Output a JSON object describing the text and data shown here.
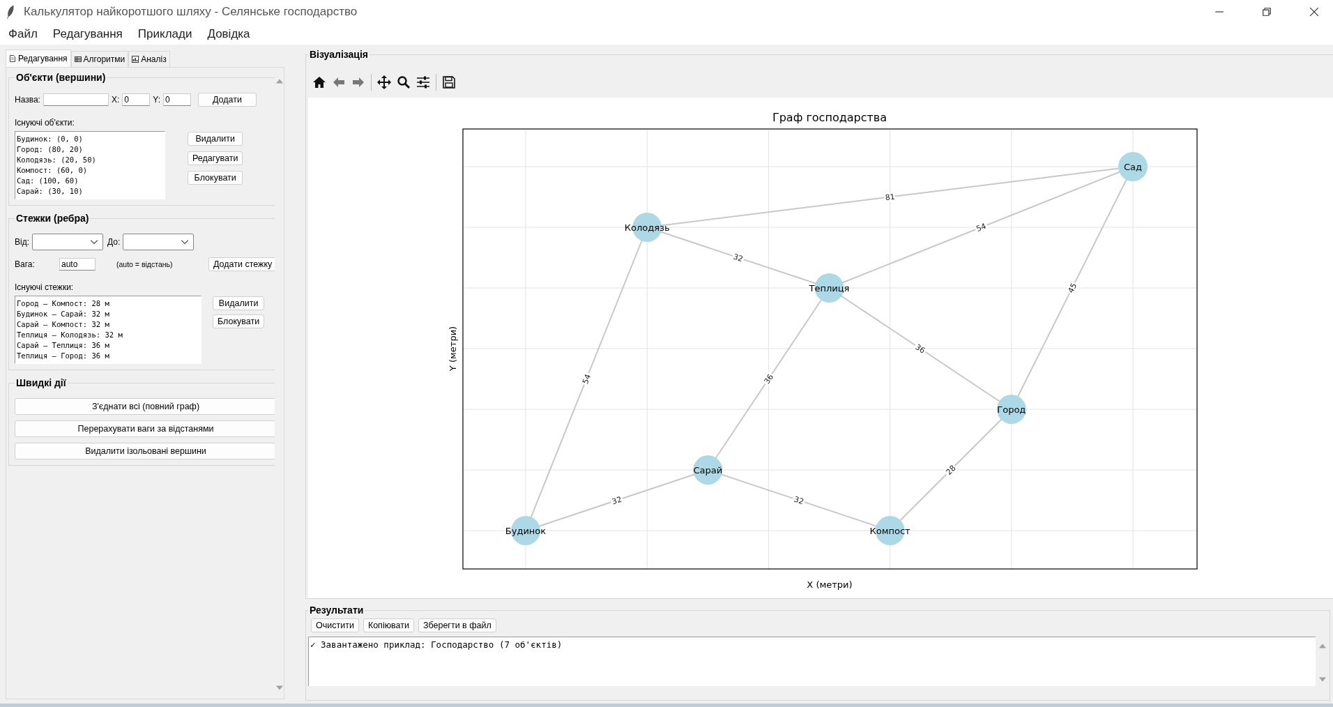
{
  "window": {
    "title": "Калькулятор найкоротшого шляху - Селянське господарство"
  },
  "menu": [
    "Файл",
    "Редагування",
    "Приклади",
    "Довідка"
  ],
  "tabs": [
    {
      "label": "Редагування",
      "selected": true
    },
    {
      "label": "Алгоритми",
      "selected": false
    },
    {
      "label": "Аналіз",
      "selected": false
    }
  ],
  "objects": {
    "title": "Об'єкти (вершини)",
    "name_label": "Назва:",
    "x_label": "X:",
    "x_value": "0",
    "y_label": "Y:",
    "y_value": "0",
    "add_button": "Додати",
    "list_label": "Існуючі об'єкти:",
    "items": [
      "Будинок: (0, 0)",
      "Город: (80, 20)",
      "Колодязь: (20, 50)",
      "Компост: (60, 0)",
      "Сад: (100, 60)",
      "Сарай: (30, 10)"
    ],
    "buttons": [
      "Видалити",
      "Редагувати",
      "Блокувати"
    ]
  },
  "paths": {
    "title": "Стежки (ребра)",
    "from_label": "Від:",
    "to_label": "До:",
    "weight_label": "Вага:",
    "weight_value": "auto",
    "hint": "(auto = відстань)",
    "add_button": "Додати стежку",
    "list_label": "Існуючі стежки:",
    "items": [
      "Город — Компост: 28 м",
      "Будинок — Сарай: 32 м",
      "Сарай — Компост: 32 м",
      "Теплиця — Колодязь: 32 м",
      "Сарай — Теплиця: 36 м",
      "Теплиця — Город: 36 м"
    ],
    "buttons": [
      "Видалити",
      "Блокувати"
    ]
  },
  "quick": {
    "title": "Швидкі дії",
    "buttons": [
      "З'єднати всі (повний граф)",
      "Перерахувати ваги за відстанями",
      "Видалити ізольовані вершини"
    ]
  },
  "visualization": {
    "title": "Візуалізація",
    "graph": {
      "title": "Граф господарства",
      "xlabel": "X (метри)",
      "ylabel": "Y (метри)",
      "nodes": [
        {
          "name": "Будинок"
        },
        {
          "name": "Город"
        },
        {
          "name": "Колодязь"
        },
        {
          "name": "Компост"
        },
        {
          "name": "Сад"
        },
        {
          "name": "Сарай"
        },
        {
          "name": "Теплиця"
        }
      ],
      "edges": [
        {
          "weight": "28"
        },
        {
          "weight": "32"
        },
        {
          "weight": "32"
        },
        {
          "weight": "32"
        },
        {
          "weight": "36"
        },
        {
          "weight": "36"
        },
        {
          "weight": "54"
        },
        {
          "weight": "54"
        },
        {
          "weight": "45"
        },
        {
          "weight": "81"
        }
      ]
    }
  },
  "results": {
    "title": "Результати",
    "buttons": [
      "Очистити",
      "Копіювати",
      "Зберегти в файл"
    ],
    "lines": [
      "✓ Завантажено приклад: Господарство (7 об'єктів)"
    ]
  }
}
